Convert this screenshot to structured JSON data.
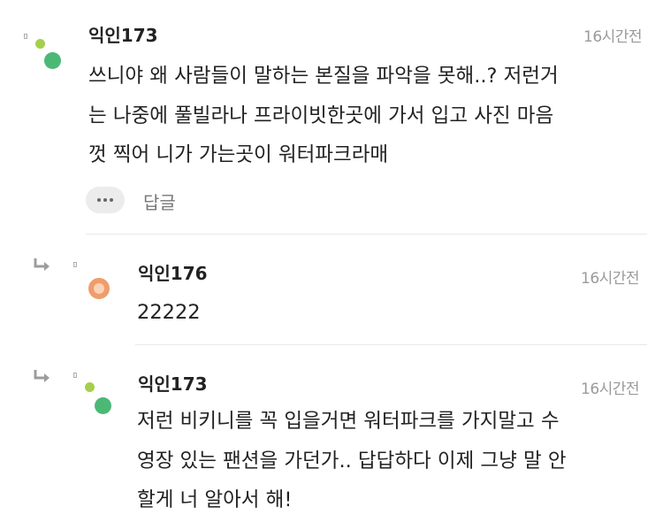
{
  "comments": [
    {
      "author": "익인173",
      "time": "16시간전",
      "lines": [
        "쓰니야 왜 사람들이 말하는 본질을 파악을 못해..? 저런거",
        "는 나중에 풀빌라나 프라이빗한곳에 가서 입고 사진 마음",
        "껏 찍어 니가 가는곳이 워터파크라매"
      ],
      "reply_label": "답글",
      "avatar_icon": "green-dots-avatar-icon"
    },
    {
      "author": "익인176",
      "time": "16시간전",
      "lines": [
        "22222"
      ],
      "avatar_icon": "orange-circle-avatar-icon"
    },
    {
      "author": "익인173",
      "time": "16시간전",
      "lines": [
        "저런 비키니를 꼭 입을거면 워터파크를 가지말고 수",
        "영장 있는 팬션을 가던가.. 답답하다 이제 그냥 말 안",
        "할게 너 알아서 해!"
      ],
      "avatar_icon": "green-dots-avatar-icon"
    }
  ],
  "colors": {
    "avatar_green": "#4cb876",
    "avatar_yellowgreen": "#a5cf4c",
    "avatar_orange": "#ef9d6c",
    "timestamp": "#9a9a9a",
    "reply": "#777777"
  },
  "icons": {
    "reply_arrow": "reply-arrow-icon",
    "more_options": "more-options-icon"
  }
}
